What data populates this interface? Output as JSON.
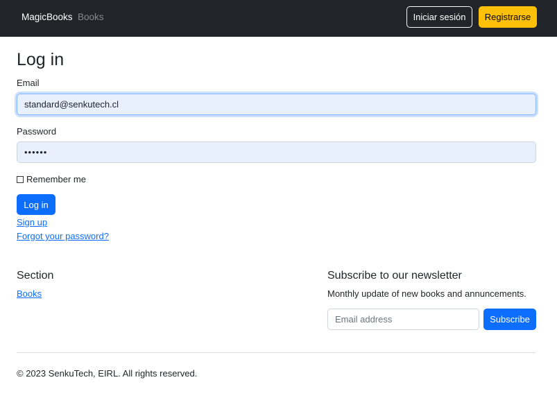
{
  "navbar": {
    "brand": "MagicBooks",
    "link_books": "Books",
    "login_button": "Iniciar sesión",
    "register_button": "Registrarse"
  },
  "login": {
    "title": "Log in",
    "email_label": "Email",
    "email_value": "standard@senkutech.cl",
    "password_label": "Password",
    "password_value": "••••••",
    "remember_label": "Remember me",
    "remember_checked": false,
    "submit_label": "Log in",
    "signup_link": "Sign up",
    "forgot_link": "Forgot your password?"
  },
  "footer": {
    "section_title": "Section",
    "section_link": "Books",
    "newsletter_title": "Subscribe to our newsletter",
    "newsletter_text": "Monthly update of new books and annuncements.",
    "email_placeholder": "Email address",
    "subscribe_label": "Subscribe",
    "copyright": "© 2023 SenkuTech, EIRL. All rights reserved."
  },
  "colors": {
    "navbar_bg": "#212529",
    "primary": "#0d6efd",
    "warning": "#ffc107",
    "autofill_bg": "#e8f0fe"
  }
}
